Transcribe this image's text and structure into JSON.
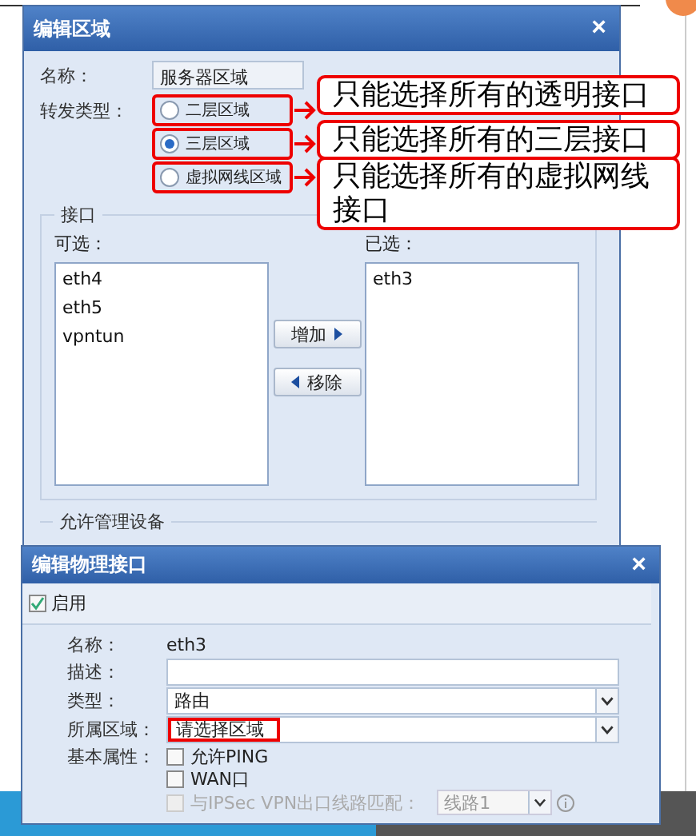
{
  "zone_dialog": {
    "title": "编辑区域",
    "close": "×",
    "name_label": "名称：",
    "name_value": "服务器区域",
    "forward_label": "转发类型：",
    "forward_types": [
      {
        "label": "二层区域",
        "selected": false
      },
      {
        "label": "三层区域",
        "selected": true
      },
      {
        "label": "虚拟网线区域",
        "selected": false
      }
    ],
    "interfaces": {
      "legend": "接口",
      "available_label": "可选：",
      "available": [
        "eth4",
        "eth5",
        "vpntun"
      ],
      "add_button": "增加",
      "remove_button": "移除",
      "chosen_label": "已选：",
      "chosen": [
        "eth3"
      ]
    },
    "management_legend": "允许管理设备"
  },
  "callouts": [
    "只能选择所有的透明接口",
    "只能选择所有的三层接口",
    "只能选择所有的虚拟网线接口"
  ],
  "interface_dialog": {
    "title": "编辑物理接口",
    "close": "×",
    "enable": {
      "label": "启用",
      "checked": true
    },
    "name_label": "名称：",
    "name_value": "eth3",
    "description_label": "描述：",
    "type_label": "类型：",
    "type_value": "路由",
    "zone_label": "所属区域：",
    "zone_value": "请选择区域",
    "attributes_label": "基本属性：",
    "attributes": [
      {
        "label": "允许PING",
        "checked": false,
        "disabled": false
      },
      {
        "label": "WAN口",
        "checked": false,
        "disabled": false
      },
      {
        "label": "与IPSec VPN出口线路匹配：",
        "checked": false,
        "disabled": true
      }
    ],
    "line_value": "线路1"
  }
}
